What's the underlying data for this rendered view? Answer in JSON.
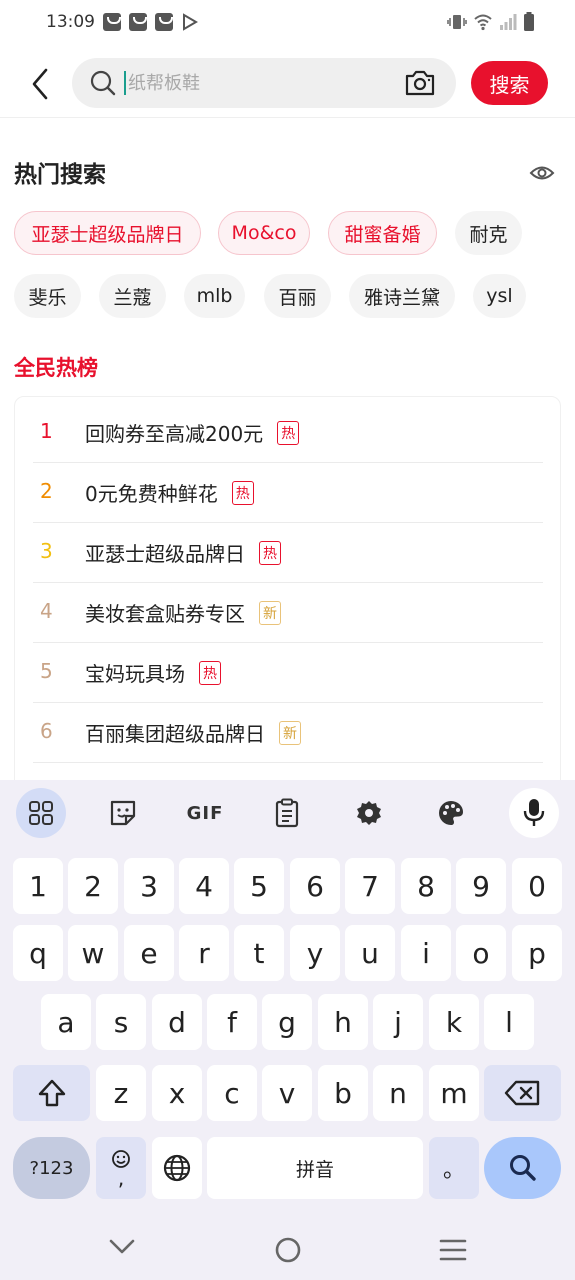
{
  "status_bar": {
    "time": "13:09"
  },
  "search": {
    "placeholder": "纸帮板鞋",
    "button_label": "搜索"
  },
  "hot_search": {
    "title": "热门搜索",
    "tags": [
      "亚瑟士超级品牌日",
      "Mo&co",
      "甜蜜备婚",
      "耐克",
      "斐乐",
      "兰蔻",
      "mlb",
      "百丽",
      "雅诗兰黛",
      "ysl"
    ]
  },
  "ranking": {
    "title": "全民热榜",
    "items": [
      {
        "rank": "1",
        "text": "回购券至高减200元",
        "badge": "热"
      },
      {
        "rank": "2",
        "text": "0元免费种鲜花",
        "badge": "热"
      },
      {
        "rank": "3",
        "text": "亚瑟士超级品牌日",
        "badge": "热"
      },
      {
        "rank": "4",
        "text": "美妆套盒贴券专区",
        "badge": "新"
      },
      {
        "rank": "5",
        "text": "宝妈玩具场",
        "badge": "热"
      },
      {
        "rank": "6",
        "text": "百丽集团超级品牌日",
        "badge": "新"
      }
    ]
  },
  "keyboard": {
    "toolbar": {
      "gif_label": "GIF"
    },
    "row_numbers": [
      "1",
      "2",
      "3",
      "4",
      "5",
      "6",
      "7",
      "8",
      "9",
      "0"
    ],
    "row1": [
      "q",
      "w",
      "e",
      "r",
      "t",
      "y",
      "u",
      "i",
      "o",
      "p"
    ],
    "row2": [
      "a",
      "s",
      "d",
      "f",
      "g",
      "h",
      "j",
      "k",
      "l"
    ],
    "row3": [
      "z",
      "x",
      "c",
      "v",
      "b",
      "n",
      "m"
    ],
    "symbols_label": "?123",
    "emoji_comma": ",",
    "space_label": "拼音",
    "period_label": "。"
  },
  "colors": {
    "accent": "#e8112d",
    "rank_1": "#e8112d",
    "rank_2": "#f08c00",
    "rank_3": "#f2bf10",
    "rank_rest": "#c9a487"
  }
}
